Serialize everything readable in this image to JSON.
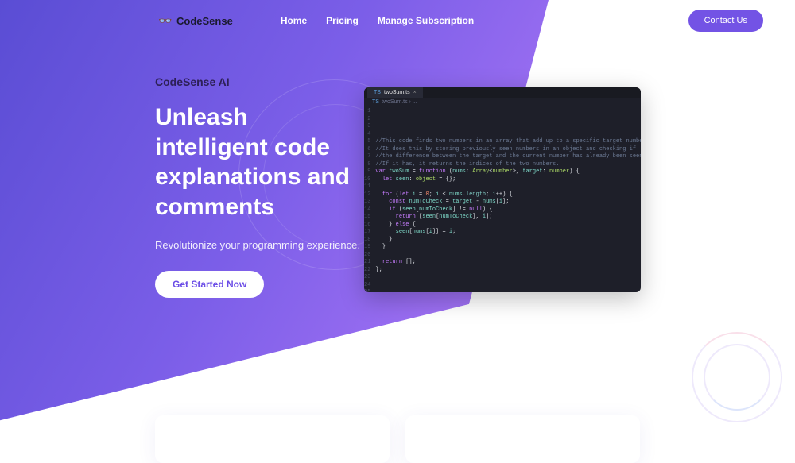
{
  "brand": {
    "name": "CodeSense",
    "logo_emoji": "👓"
  },
  "nav": {
    "links": [
      "Home",
      "Pricing",
      "Manage Subscription"
    ],
    "contact": "Contact Us"
  },
  "hero": {
    "eyebrow": "CodeSense AI",
    "headline": "Unleash intelligent code explanations and comments",
    "subhead": "Revolutionize your programming experience.",
    "cta": "Get Started Now"
  },
  "editor": {
    "filename": "twoSum.ts",
    "breadcrumb": "twoSum.ts › ...",
    "lines": [
      "",
      "",
      "",
      "",
      "//This code finds two numbers in an array that add up to a specific target number.",
      "//It does this by storing previously seen numbers in an object and checking if",
      "//the difference between the target and the current number has already been seen.",
      "//If it has, it returns the indices of the two numbers.",
      "var twoSum = function (nums: Array<number>, target: number) {",
      "  let seen: object = {};",
      "",
      "  for (let i = 0; i < nums.length; i++) {",
      "    const numToCheck = target - nums[i];",
      "    if (seen[numToCheck] != null) {",
      "      return [seen[numToCheck], i];",
      "    } else {",
      "      seen[nums[i]] = i;",
      "    }",
      "  }",
      "",
      "  return [];",
      "};",
      "",
      "",
      "",
      ""
    ]
  }
}
